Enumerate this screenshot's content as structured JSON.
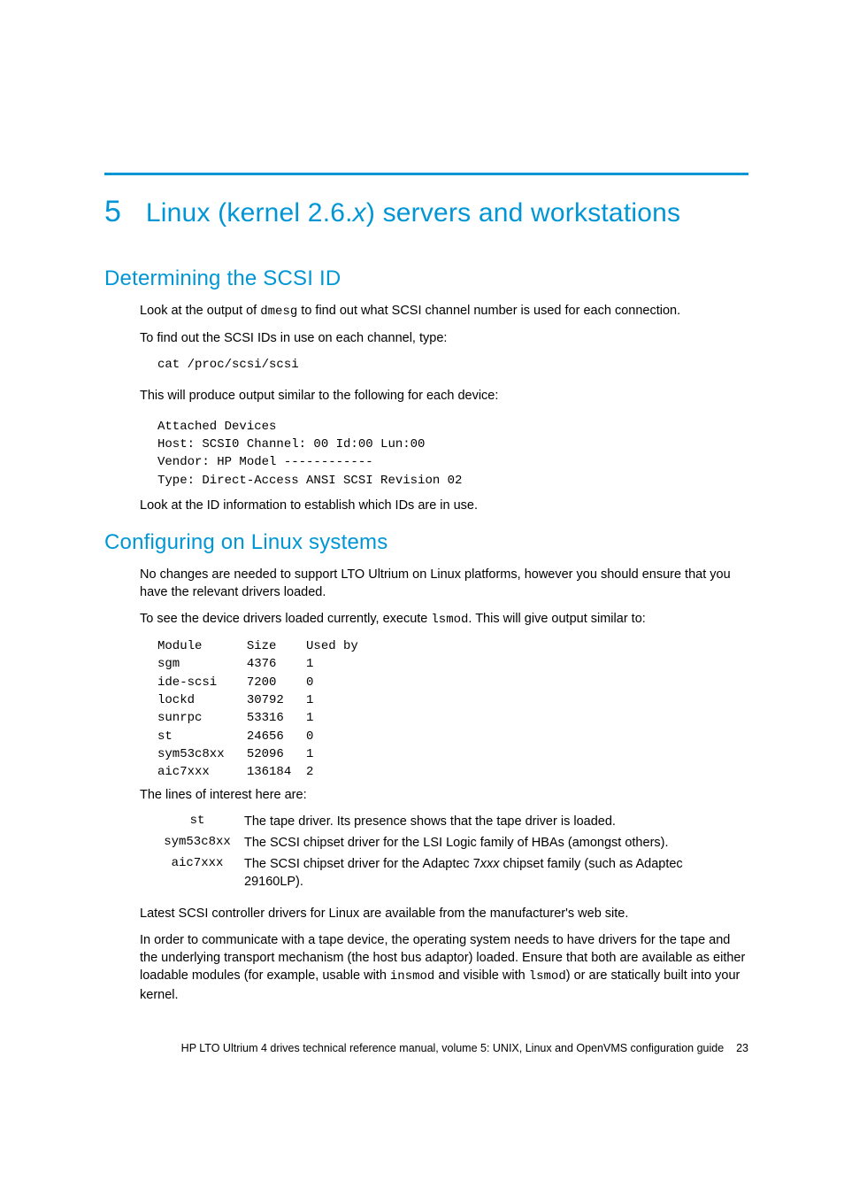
{
  "chapter": {
    "number": "5",
    "title_pre": "Linux (kernel 2.6.",
    "title_ital": "x",
    "title_post": ") servers and workstations"
  },
  "sec1": {
    "title": "Determining the SCSI ID",
    "p1a": "Look at the output of ",
    "p1_code": "dmesg",
    "p1b": " to find out what SCSI channel number is used for each connection.",
    "p2": "To find out the SCSI IDs in use on each channel, type:",
    "cmd1": "cat /proc/scsi/scsi",
    "p3": "This will produce output similar to the following for each device:",
    "out1": "Attached Devices\nHost: SCSI0 Channel: 00 Id:00 Lun:00\nVendor: HP Model ------------\nType: Direct-Access ANSI SCSI Revision 02",
    "p4": "Look at the ID information to establish which IDs are in use."
  },
  "sec2": {
    "title": "Configuring on Linux systems",
    "p1": "No changes are needed to support LTO Ultrium on Linux platforms, however you should ensure that you have the relevant drivers loaded.",
    "p2a": "To see the device drivers loaded currently, execute ",
    "p2_code": "lsmod",
    "p2b": ". This will give output similar to:",
    "out1": "Module      Size    Used by\nsgm         4376    1\nide-scsi    7200    0\nlockd       30792   1\nsunrpc      53316   1\nst          24656   0\nsym53c8xx   52096   1\naic7xxx     136184  2",
    "p3": "The lines of interest here are:",
    "drivers": [
      {
        "name": "st",
        "desc_pre": "The tape driver. Its presence shows that the tape driver is loaded.",
        "ital": "",
        "desc_post": ""
      },
      {
        "name": "sym53c8xx",
        "desc_pre": "The SCSI chipset driver for the LSI Logic family of HBAs (amongst others).",
        "ital": "",
        "desc_post": ""
      },
      {
        "name": "aic7xxx",
        "desc_pre": "The SCSI chipset driver for the Adaptec 7",
        "ital": "xxx",
        "desc_post": " chipset family (such as Adaptec 29160LP)."
      }
    ],
    "p4": "Latest SCSI controller drivers for Linux are available from the manufacturer's web site.",
    "p5a": "In order to communicate with a tape device, the operating system needs to have drivers for the tape and the underlying transport mechanism (the host bus adaptor) loaded. Ensure that both are available as either loadable modules (for example, usable with ",
    "p5_code1": "insmod",
    "p5b": " and visible with ",
    "p5_code2": "lsmod",
    "p5c": ") or are statically built into your kernel."
  },
  "footer": {
    "text": "HP LTO Ultrium 4 drives technical reference manual, volume 5: UNIX, Linux and OpenVMS configuration guide",
    "page": "23"
  }
}
